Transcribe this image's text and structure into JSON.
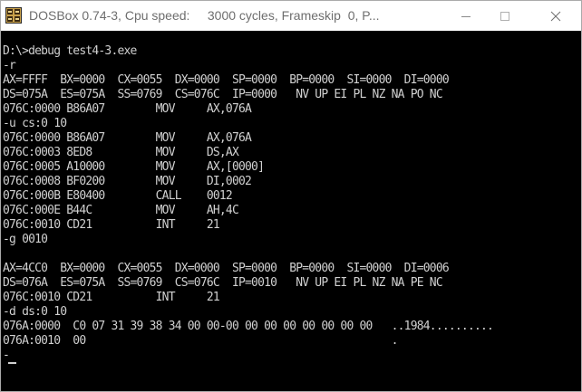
{
  "window": {
    "title": "DOSBox 0.74-3, Cpu speed:     3000 cycles, Frameskip  0, P...",
    "icon": "dosbox-app-icon",
    "controls": [
      "minimize-icon",
      "maximize-icon",
      "close-icon"
    ]
  },
  "console": {
    "text_color": "#d0d0d0",
    "background": "#000000",
    "lines": [
      "D:\\>debug test4-3.exe",
      "-r",
      "AX=FFFF  BX=0000  CX=0055  DX=0000  SP=0000  BP=0000  SI=0000  DI=0000",
      "DS=075A  ES=075A  SS=0769  CS=076C  IP=0000   NV UP EI PL NZ NA PO NC",
      "076C:0000 B86A07        MOV     AX,076A",
      "-u cs:0 10",
      "076C:0000 B86A07        MOV     AX,076A",
      "076C:0003 8ED8          MOV     DS,AX",
      "076C:0005 A10000        MOV     AX,[0000]",
      "076C:0008 BF0200        MOV     DI,0002",
      "076C:000B E80400        CALL    0012",
      "076C:000E B44C          MOV     AH,4C",
      "076C:0010 CD21          INT     21",
      "-g 0010",
      "",
      "AX=4CC0  BX=0000  CX=0055  DX=0000  SP=0000  BP=0000  SI=0000  DI=0006",
      "DS=076A  ES=075A  SS=0769  CS=076C  IP=0010   NV UP EI PL NZ NA PE NC",
      "076C:0010 CD21          INT     21",
      "-d ds:0 10",
      "076A:0000  C0 07 31 39 38 34 00 00-00 00 00 00 00 00 00 00   ..1984..........",
      "076A:0010  00                                                .",
      "-"
    ]
  }
}
